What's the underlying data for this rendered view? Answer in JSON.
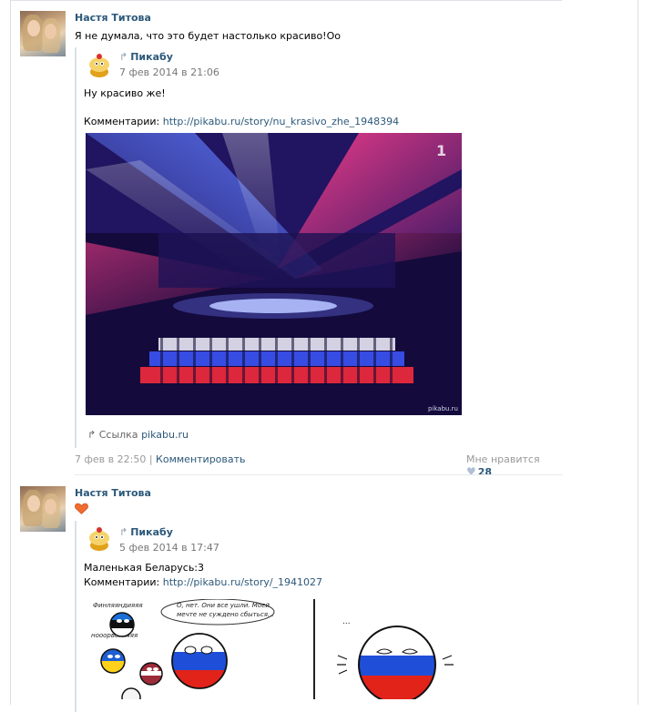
{
  "posts": [
    {
      "author": "Настя Титова",
      "text": "Я не думала, что это будет настолько красиво!Оо",
      "repost": {
        "source": "Пикабу",
        "date": "7 фев 2014 в 21:06",
        "text": "Ну красиво же!",
        "comments_label": "Комментарии:",
        "comments_link": "http://pikabu.ru/story/nu_krasivo_zhe_1948394",
        "image_watermark": "pikabu.ru",
        "link_label": "Ссылка",
        "link_domain": "pikabu.ru"
      },
      "footer": {
        "date": "7 фев в 22:50",
        "separator": "|",
        "comment_label": "Комментировать",
        "like_label": "Мне нравится",
        "likes": "28"
      }
    },
    {
      "author": "Настя Титова",
      "text_icon": "heart-emoji-icon",
      "repost": {
        "source": "Пикабу",
        "date": "5 фев 2014 в 17:47",
        "text": "Маленькая Беларусь:3",
        "comments_label": "Комментарии:",
        "comments_link": "http://pikabu.ru/story/_1941027",
        "comic_caption_1": "Финляяндияяя",
        "comic_caption_2": "нооорвегияяя",
        "comic_bubble": "О, нет. Они все ушли. Моей мечте не суждено сбыться...",
        "comic_dots": "..."
      }
    }
  ],
  "colors": {
    "link": "#2b587a",
    "muted": "#999999",
    "heart": "#f06b2e"
  }
}
